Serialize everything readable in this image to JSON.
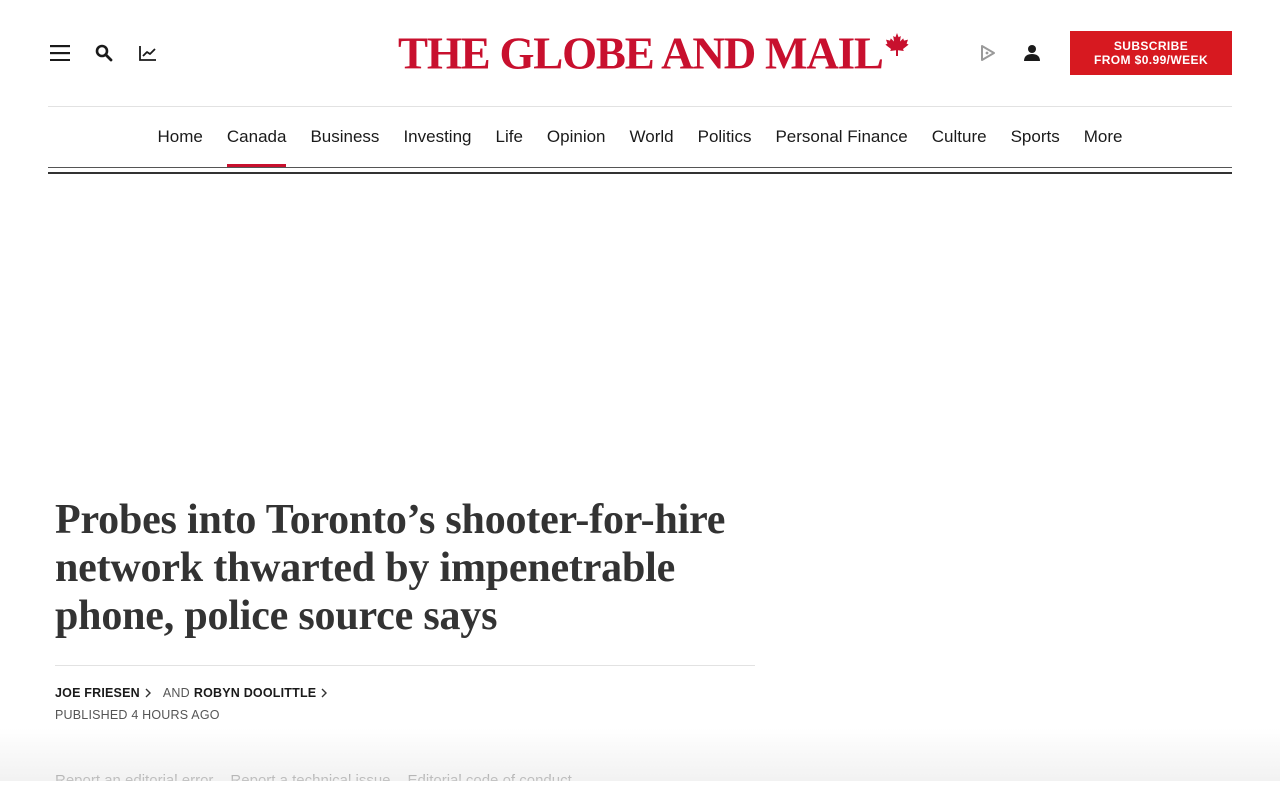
{
  "masthead": {
    "logo_text": "THE GLOBE AND MAIL",
    "brand_color": "#c8102e",
    "subscribe_line1": "SUBSCRIBE",
    "subscribe_line2": "FROM $0.99/WEEK",
    "subscribe_color": "#d71920",
    "icons": [
      "menu-icon",
      "search-icon",
      "chart-icon",
      "play-icon",
      "account-icon",
      "maple-leaf-icon"
    ]
  },
  "nav": {
    "items": [
      {
        "label": "Home"
      },
      {
        "label": "Canada",
        "active": true
      },
      {
        "label": "Business"
      },
      {
        "label": "Investing"
      },
      {
        "label": "Life"
      },
      {
        "label": "Opinion"
      },
      {
        "label": "World"
      },
      {
        "label": "Politics"
      },
      {
        "label": "Personal Finance"
      },
      {
        "label": "Culture"
      },
      {
        "label": "Sports"
      },
      {
        "label": "More"
      }
    ]
  },
  "article": {
    "headline": "Probes into Toronto’s shooter-for-hire network thwarted by impenetrable phone, police source says",
    "authors": [
      "JOE FRIESEN",
      "ROBYN DOOLITTLE"
    ],
    "and_text": "AND",
    "published": "PUBLISHED 4 HOURS AGO"
  },
  "footer": {
    "links": [
      "Report an editorial error",
      "Report a technical issue",
      "Editorial code of conduct"
    ]
  }
}
